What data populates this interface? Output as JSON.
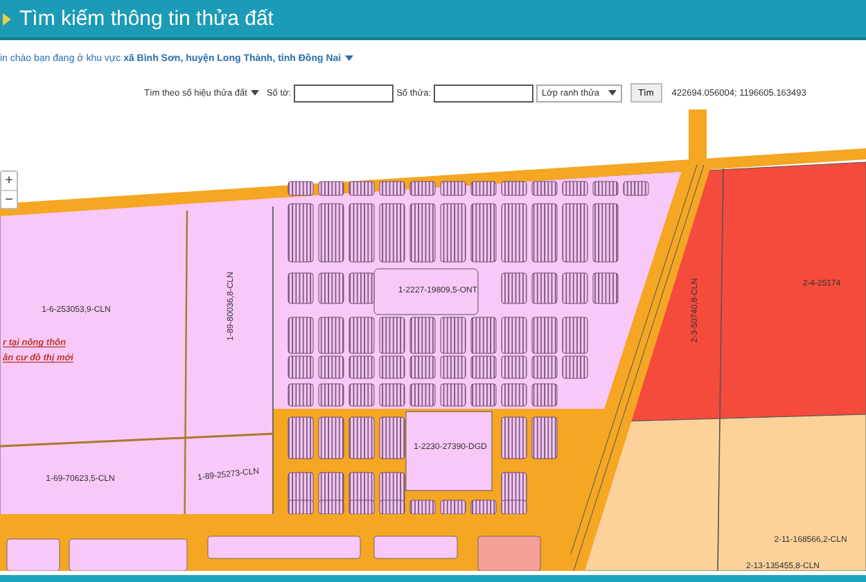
{
  "header": {
    "title": "Tìm kiếm thông tin thửa đất"
  },
  "greeting": {
    "text": "in chào bạn đang ở khu vực **xã Bình Sơn, huyện Long Thành, tỉnh Đồng Nai**"
  },
  "search": {
    "mode": "Tìm theo số hiệu thửa đất",
    "sheet_label": "Số tờ:",
    "parcel_label": "Số thửa:",
    "layer": "Lớp ranh thửa",
    "button": "Tìm",
    "coordinates": "422694.056004; 1196605.163493"
  },
  "map": {
    "zoom_in": "+",
    "zoom_out": "−",
    "parcels": [
      {
        "label": "1-6-253053,9-CLN"
      },
      {
        "label": "1-89-80036,8-CLN"
      },
      {
        "label": "1-2227-19809,5-ONT"
      },
      {
        "label": "2-3-50740,8-CLN"
      },
      {
        "label": "2-4-25174"
      },
      {
        "label": "1-2230-27390-DGD"
      },
      {
        "label": "1-69-70623,5-CLN"
      },
      {
        "label": "1-89-25273-CLN"
      },
      {
        "label": "2-11-168566,2-CLN"
      },
      {
        "label": "2-13-135455,8-CLN"
      }
    ],
    "notes": [
      "r tại nông thôn",
      "ân cư đô thị mới"
    ]
  }
}
